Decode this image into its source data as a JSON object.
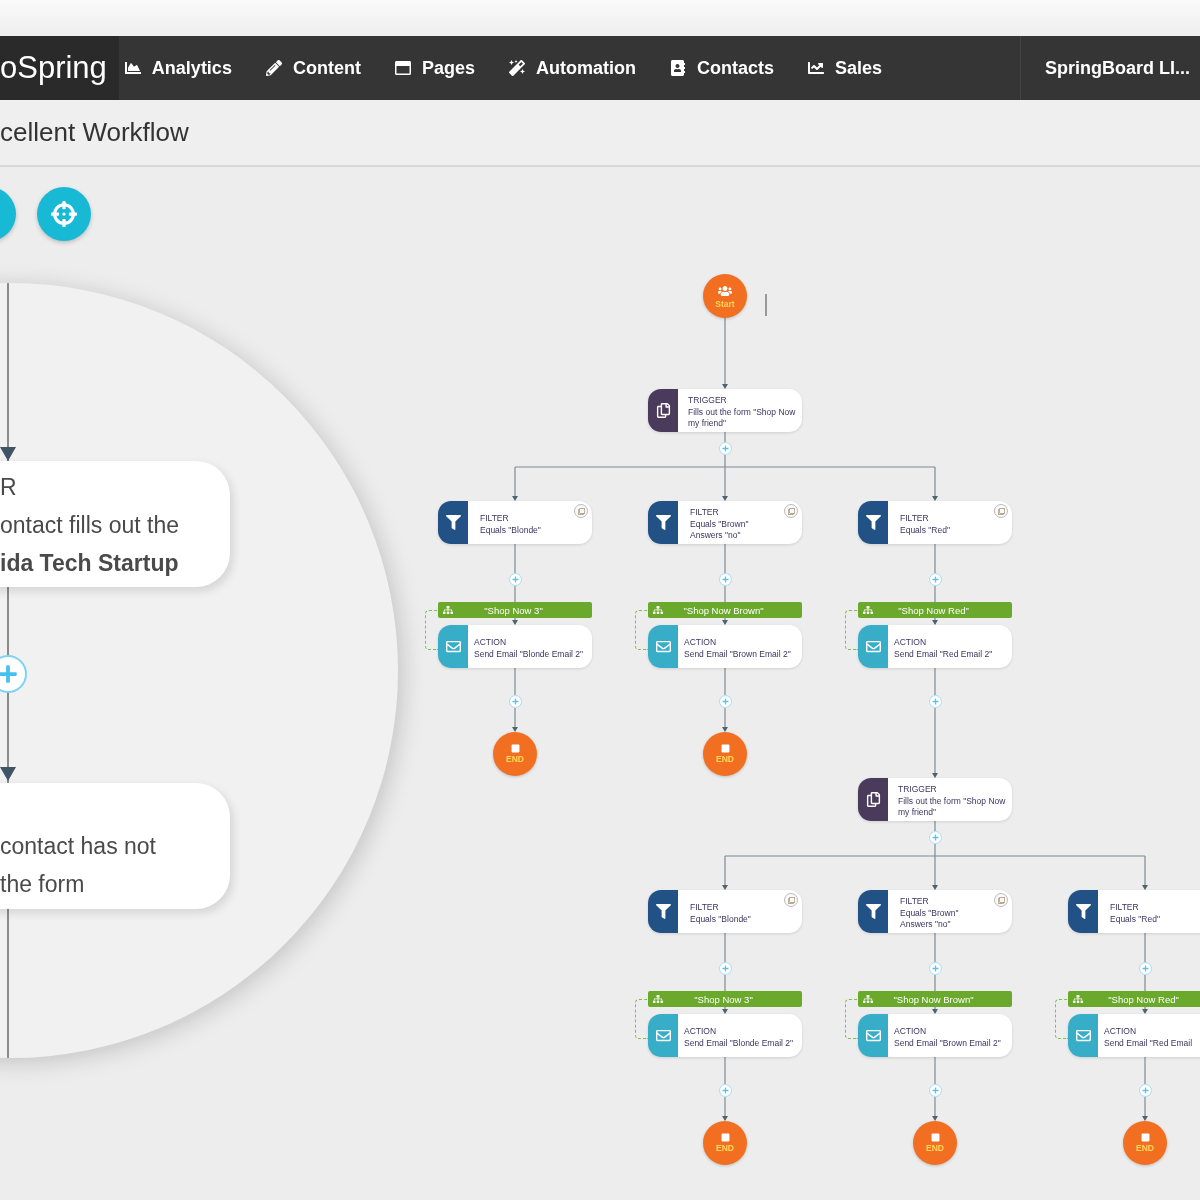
{
  "nav": {
    "logo": "oSpring",
    "items": [
      {
        "label": "Analytics"
      },
      {
        "label": "Content"
      },
      {
        "label": "Pages"
      },
      {
        "label": "Automation"
      },
      {
        "label": "Contacts"
      },
      {
        "label": "Sales"
      }
    ],
    "account": "SpringBoard LI..."
  },
  "title": "cellent Workflow",
  "magnifier": {
    "cards": [
      {
        "lines": [
          {
            "text": "R",
            "bold": false
          },
          {
            "text": "ontact fills out the",
            "bold": false
          },
          {
            "text": "ida Tech Startup",
            "bold": true
          }
        ]
      },
      {
        "lines": [
          {
            "text": "contact has not",
            "bold": false
          },
          {
            "text": "the form",
            "bold": false
          }
        ]
      }
    ]
  },
  "workflow": {
    "start": "Start",
    "groups": [
      {
        "trigger": {
          "label": "TRIGGER",
          "text": "Fills out the form \"Shop Now my friend\""
        },
        "branches": [
          {
            "filter": {
              "label": "FILTER",
              "lines": [
                "Equals \"Blonde\""
              ]
            },
            "tag": "\"Shop Now 3\"",
            "action": {
              "label": "ACTION",
              "text": "Send Email \"Blonde Email 2\""
            },
            "end": "END"
          },
          {
            "filter": {
              "label": "FILTER",
              "lines": [
                "Equals \"Brown\"",
                "Answers \"no\""
              ]
            },
            "tag": "\"Shop Now Brown\"",
            "action": {
              "label": "ACTION",
              "text": "Send Email \"Brown Email 2\""
            },
            "end": "END"
          },
          {
            "filter": {
              "label": "FILTER",
              "lines": [
                "Equals \"Red\""
              ]
            },
            "tag": "\"Shop Now Red\"",
            "action": {
              "label": "ACTION",
              "text": "Send Email \"Red Email 2\""
            }
          }
        ]
      },
      {
        "trigger": {
          "label": "TRIGGER",
          "text": "Fills out the form \"Shop Now my friend\""
        },
        "branches": [
          {
            "filter": {
              "label": "FILTER",
              "lines": [
                "Equals \"Blonde\""
              ]
            },
            "tag": "\"Shop Now 3\"",
            "action": {
              "label": "ACTION",
              "text": "Send Email \"Blonde Email 2\""
            },
            "end": "END"
          },
          {
            "filter": {
              "label": "FILTER",
              "lines": [
                "Equals \"Brown\"",
                "Answers \"no\""
              ]
            },
            "tag": "\"Shop Now Brown\"",
            "action": {
              "label": "ACTION",
              "text": "Send Email \"Brown Email 2\""
            },
            "end": "END"
          },
          {
            "filter": {
              "label": "FILTER",
              "lines": [
                "Equals \"Red\""
              ]
            },
            "tag": "\"Shop Now Red\"",
            "action": {
              "label": "ACTION",
              "text": "Send Email \"Red Email"
            },
            "end": "END"
          }
        ]
      }
    ]
  }
}
